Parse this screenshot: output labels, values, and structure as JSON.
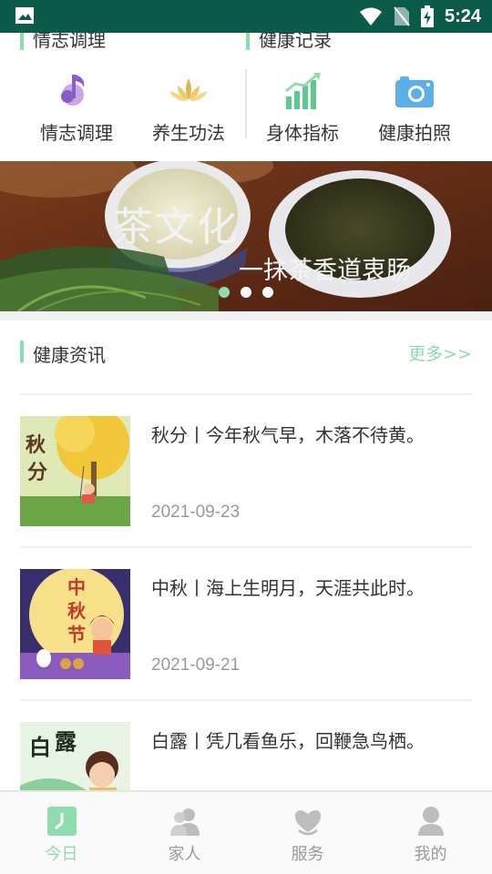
{
  "status_bar": {
    "time": "5:24"
  },
  "sections": {
    "emotion": "情志调理",
    "health_record": "健康记录"
  },
  "quick_items": [
    {
      "label": "情志调理",
      "icon": "music-note-icon"
    },
    {
      "label": "养生功法",
      "icon": "lotus-icon"
    },
    {
      "label": "身体指标",
      "icon": "bar-chart-icon"
    },
    {
      "label": "健康拍照",
      "icon": "camera-icon"
    }
  ],
  "banner": {
    "title": "茶文化",
    "subtitle": "一抹茶香道衷肠",
    "pages": 3,
    "active_page": 1
  },
  "news": {
    "header": "健康资讯",
    "more": "更多>>",
    "items": [
      {
        "title": "秋分丨今年秋气早，木落不待黄。",
        "date": "2021-09-23",
        "thumb_text": [
          "秋",
          "分"
        ]
      },
      {
        "title": "中秋丨海上生明月，天涯共此时。",
        "date": "2021-09-21",
        "thumb_text": [
          "中",
          "秋",
          "节"
        ]
      },
      {
        "title": "白露丨凭几看鱼乐，回鞭急鸟栖。",
        "date": "",
        "thumb_text": [
          "白",
          "露"
        ]
      }
    ]
  },
  "tabs": [
    {
      "label": "今日",
      "active": true,
      "icon": "today-icon"
    },
    {
      "label": "家人",
      "active": false,
      "icon": "family-icon"
    },
    {
      "label": "服务",
      "active": false,
      "icon": "service-icon"
    },
    {
      "label": "我的",
      "active": false,
      "icon": "profile-icon"
    }
  ],
  "colors": {
    "status_bar": "#0b5a4a",
    "accent_green": "#8fdcae",
    "text": "#333333",
    "muted": "#999999"
  }
}
